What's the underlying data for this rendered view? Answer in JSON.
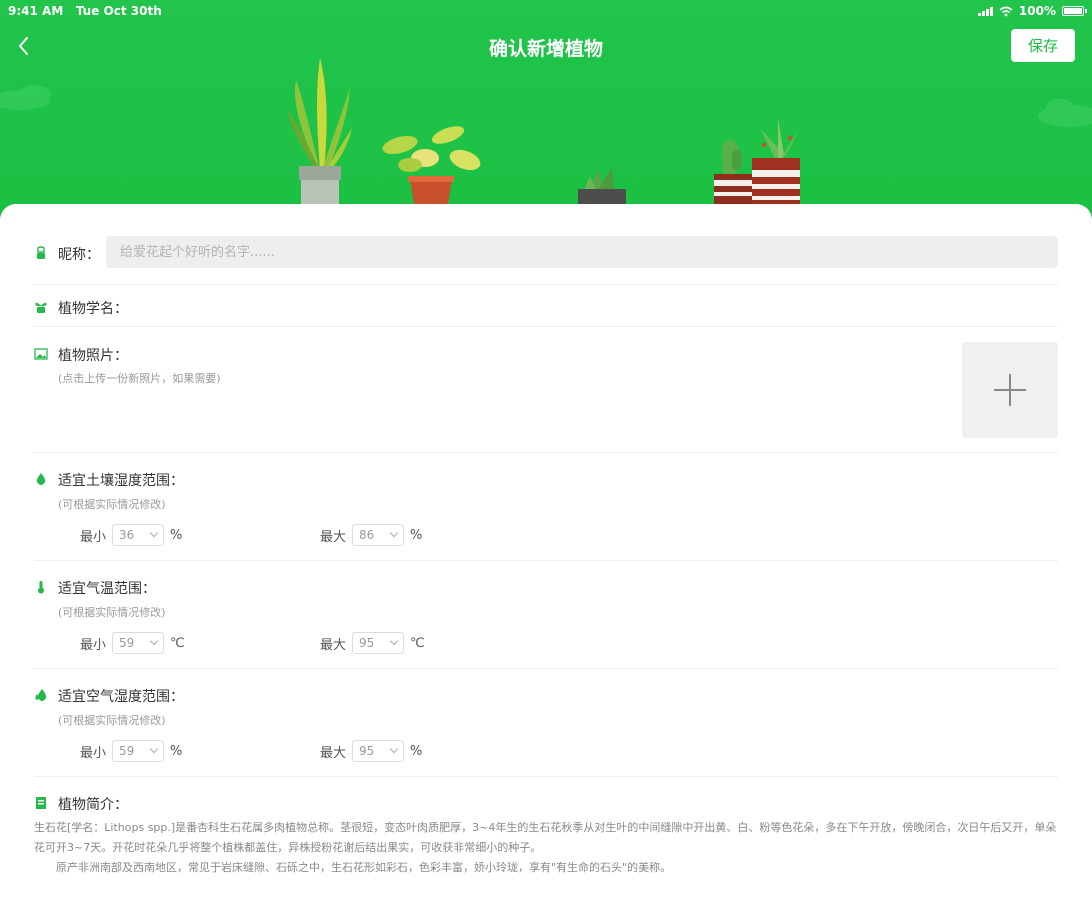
{
  "status_bar": {
    "time": "9:41 AM",
    "date": "Tue Oct 30th",
    "battery": "100%"
  },
  "nav": {
    "title": "确认新增植物",
    "save_label": "保存"
  },
  "form": {
    "nickname": {
      "label": "昵称：",
      "placeholder": "给爱花起个好听的名字......"
    },
    "scientific_name": {
      "label": "植物学名："
    },
    "photo": {
      "label": "植物照片：",
      "hint": "(点击上传一份新照片，如果需要)"
    },
    "soil_humidity": {
      "label": "适宜土壤湿度范围：",
      "hint": "(可根据实际情况修改)",
      "min_label": "最小",
      "min_value": "36",
      "max_label": "最大",
      "max_value": "86",
      "unit": "%"
    },
    "temperature": {
      "label": "适宜气温范围：",
      "hint": "(可根据实际情况修改)",
      "min_label": "最小",
      "min_value": "59",
      "max_label": "最大",
      "max_value": "95",
      "unit": "℃"
    },
    "air_humidity": {
      "label": "适宜空气湿度范围：",
      "hint": "(可根据实际情况修改)",
      "min_label": "最小",
      "min_value": "59",
      "max_label": "最大",
      "max_value": "95",
      "unit": "%"
    },
    "description": {
      "label": "植物简介：",
      "line1": "生石花[学名：Lithops spp.]是番杏科生石花属多肉植物总称。茎很短，变态叶肉质肥厚，3~4年生的生石花秋季从对生叶的中间缝隙中开出黄、白、粉等色花朵，多在下午开放，傍晚闭合，次日午后又开，单朵花可开3~7天。开花时花朵几乎将整个植株都盖住，异株授粉花谢后结出果实，可收获非常细小的种子。",
      "line2": "原产非洲南部及西南地区，常见于岩床缝隙、石砾之中，生石花形如彩石，色彩丰富，娇小玲珑，享有\"有生命的石头\"的美称。"
    }
  },
  "colors": {
    "primary": "#1ac042",
    "icon": "#26b84a"
  }
}
